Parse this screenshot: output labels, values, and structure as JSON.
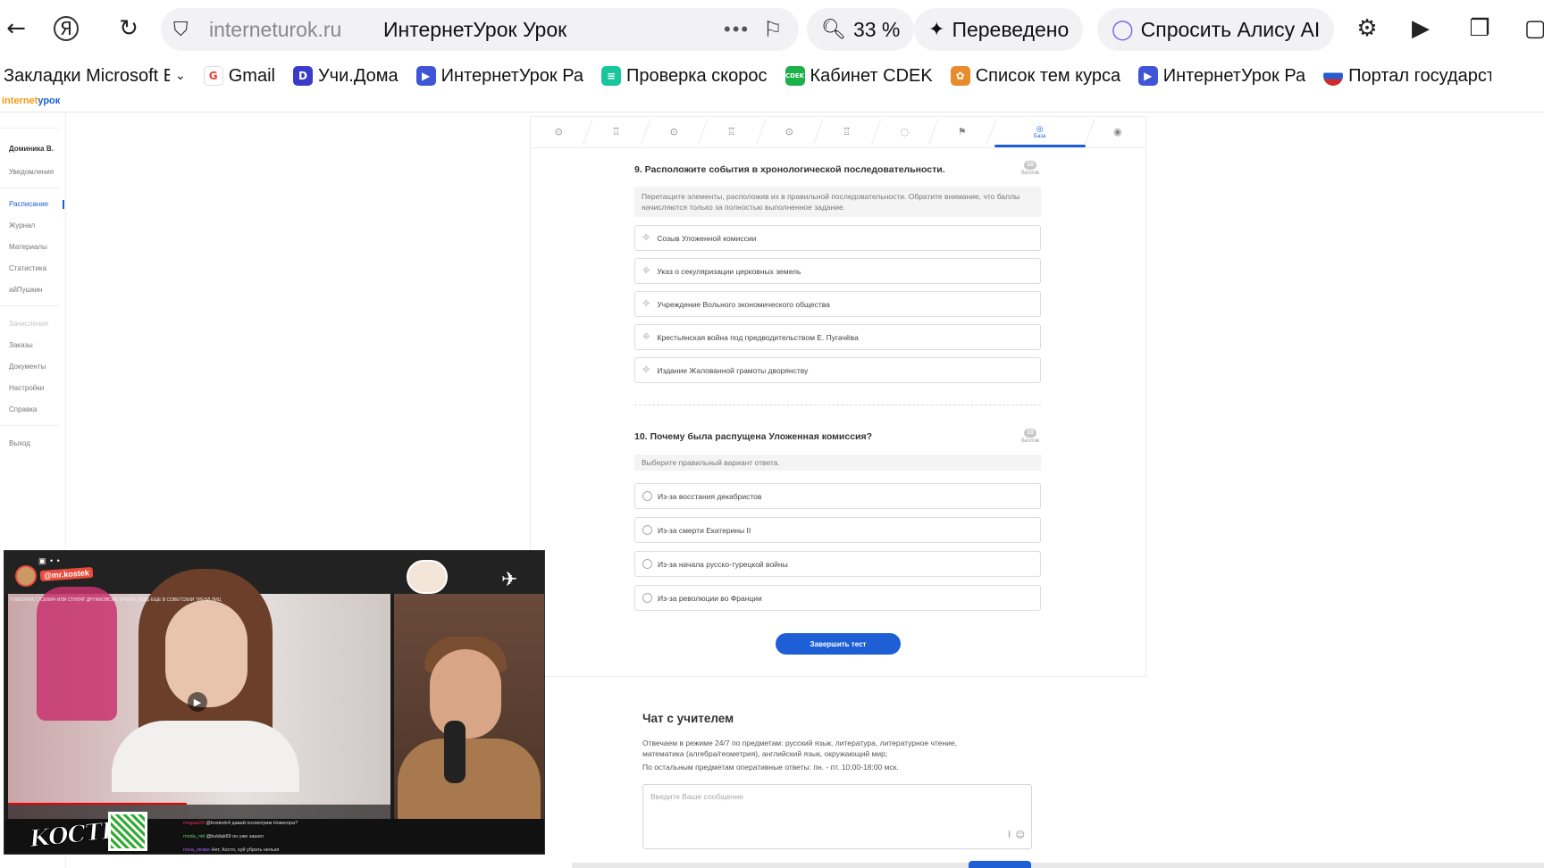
{
  "browser": {
    "domain": "interneturok.ru",
    "page_title": "ИнтернетУрок Урок",
    "zoom": "33 %",
    "translated": "Переведено",
    "ask_alice": "Спросить Алису AI",
    "bookmarks": [
      {
        "label": "Закладки Microsoft E",
        "color": "#ffffff"
      },
      {
        "label": "Gmail",
        "color": "#ea4335"
      },
      {
        "label": "Учи.Дома",
        "color": "#3b3bc9"
      },
      {
        "label": "ИнтернетУрок Ра",
        "color": "#3e55d8"
      },
      {
        "label": "Проверка скорос",
        "color": "#19c59a"
      },
      {
        "label": "Кабинет CDEK",
        "color": "#1ab248"
      },
      {
        "label": "Список тем курса",
        "color": "#e88b2a"
      },
      {
        "label": "ИнтернетУрок Ра",
        "color": "#3e55d8"
      },
      {
        "label": "Портал государст",
        "color": "#d02b2b"
      }
    ]
  },
  "site": {
    "logo_a": "internet",
    "logo_b": "урок"
  },
  "sidebar": {
    "user": "Доминика В.",
    "notifications": "Уведомления",
    "items": [
      "Расписание",
      "Журнал",
      "Материалы",
      "Статистика",
      "айПушкин"
    ],
    "section2_header": "Зачисления",
    "items2": [
      "Заказы",
      "Документы",
      "Настройки",
      "Справка"
    ],
    "logout": "Выход"
  },
  "steps": {
    "active_label": "База"
  },
  "q9": {
    "title": "9. Расположите события в хронологической последовательности.",
    "points": "10",
    "points_label": "баллов",
    "hint": "Перетащите элементы, расположив их в правильной последовательности. Обратите внимание, что баллы начисляются только за полностью выполненное задание.",
    "items": [
      "Созыв Уложенной комиссии",
      "Указ о секуляризации церковных земель",
      "Учреждение Вольного экономического общества",
      "Крестьянская война под предводительством Е. Пугачёва",
      "Издание Жалованной грамоты дворянству"
    ]
  },
  "q10": {
    "title": "10. Почему была распущена Уложенная комиссия?",
    "points": "10",
    "points_label": "баллов",
    "hint": "Выберите правильный вариант ответа.",
    "options": [
      "Из-за восстания декабристов",
      "Из-за смерти Екатерины II",
      "Из-за начала русско-турецкой войны",
      "Из-за революции во Франции"
    ]
  },
  "finish_button": "Завершить тест",
  "chat": {
    "title": "Чат с учителем",
    "line1": "Отвечаем в режиме 24/7 по предметам: русский язык, литература, литературное чтение,",
    "line2": "математика (алгебра/геометрия), английский язык, окружающий мир;",
    "line3": "По остальным предметам оперативные ответы: пн. - пт. 10:00-18:00 мск.",
    "placeholder": "Введите Ваше сообщение"
  },
  "pip": {
    "channel": "@mr.kostek",
    "video_title": "ТУМБОЧКА ГУСЕВИЧ ИЛИ СТИЛЯГ ДРУЖКОВСКА. ВРЕМЯ, ВЕДЬ ЕЩЕ В СОВЕТСКИЙ ТРЕНД ЛИЦ",
    "logo": "KOCTEK",
    "chat": [
      {
        "user": "mogaw29",
        "text": "@kosteek4 давай посмотрим Новатора?"
      },
      {
        "user": "mnda_nid",
        "text": "@buldak69 он уже зашел"
      },
      {
        "user": "nova_strake",
        "text": "Нет, Костя, хуй убрать нельзя"
      }
    ]
  }
}
